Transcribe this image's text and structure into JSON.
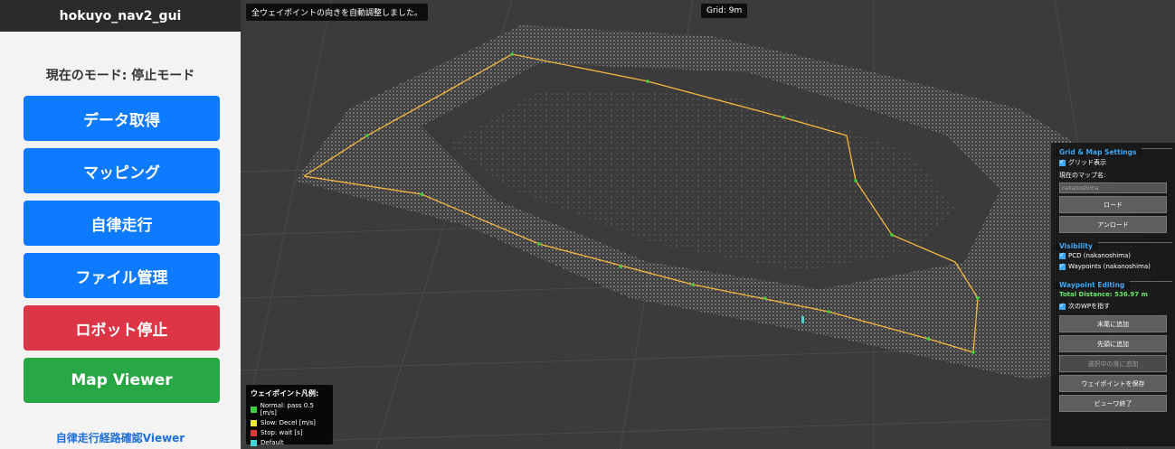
{
  "sidebar": {
    "app_title": "hokuyo_nav2_gui",
    "mode_text": "現在のモード: 停止モード",
    "buttons": {
      "data_acquisition": "データ取得",
      "mapping": "マッピング",
      "autonomous": "自律走行",
      "file_management": "ファイル管理",
      "robot_stop": "ロボット停止",
      "map_viewer": "Map Viewer"
    },
    "bottom_link": "自律走行経路確認Viewer"
  },
  "viewer": {
    "status_message": "全ウェイポイントの向きを自動調整しました。",
    "grid_label": "Grid: 9m",
    "legend": {
      "title": "ウェイポイント凡例:",
      "items": [
        {
          "color": "#3ecf3e",
          "label": "Normal: pass 0.5 [m/s]"
        },
        {
          "color": "#f0e63c",
          "label": "Slow: Decel [m/s]"
        },
        {
          "color": "#e53935",
          "label": "Stop: wait [s]"
        },
        {
          "color": "#3fd6d6",
          "label": "Default"
        }
      ]
    }
  },
  "panel": {
    "grid_map": {
      "title": "Grid & Map Settings",
      "grid_checkbox": "グリッド表示",
      "map_name_label": "現在のマップ名:",
      "map_name_value": "nakanoshima",
      "load_button": "ロード",
      "unload_button": "アンロード"
    },
    "visibility": {
      "title": "Visibility",
      "pcd_checkbox": "PCD (nakanoshima)",
      "waypoints_checkbox": "Waypoints (nakanoshima)"
    },
    "waypoint_editing": {
      "title": "Waypoint Editing",
      "total_distance": "Total Distance: 536.97 m",
      "point_next_checkbox": "次のWPを指す",
      "add_end_button": "末尾に追加",
      "add_start_button": "先頭に追加",
      "add_after_selected_button": "選択中の後に追加",
      "save_button": "ウェイポイントを保存",
      "exit_view_button": "ビューワ終了"
    }
  },
  "colors": {
    "primary_blue": "#0d7bff",
    "danger_red": "#dc3545",
    "success_green": "#28a745",
    "panel_accent": "#3fa9f5"
  }
}
